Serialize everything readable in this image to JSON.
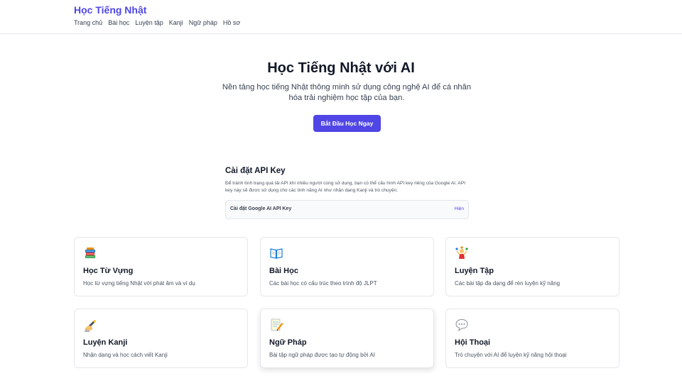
{
  "header": {
    "brand": "Học Tiếng Nhật",
    "nav": [
      "Trang chủ",
      "Bài học",
      "Luyện tập",
      "Kanji",
      "Ngữ pháp",
      "Hồ sơ"
    ]
  },
  "hero": {
    "title": "Học Tiếng Nhật với AI",
    "subtitle": "Nền tảng học tiếng Nhật thông minh sử dụng công nghệ AI để cá nhân hóa trải nghiệm học tập của bạn.",
    "cta_label": "Bắt Đầu Học Ngay"
  },
  "api_key": {
    "title": "Cài đặt API Key",
    "description": "Để tránh tình trạng quá tải API khi nhiều người cùng sử dụng, bạn có thể cấu hình API key riêng của Google AI. API key này sẽ được sử dụng cho các tính năng AI như nhận dạng Kanji và trò chuyện.",
    "box_label": "Cài đặt Google AI API Key",
    "toggle_label": "Hiện"
  },
  "cards": [
    {
      "icon": "books-icon",
      "title": "Học Từ Vựng",
      "desc": "Học từ vựng tiếng Nhật với phát âm và ví dụ"
    },
    {
      "icon": "open-book-icon",
      "title": "Bài Học",
      "desc": "Các bài học có cấu trúc theo trình độ JLPT"
    },
    {
      "icon": "juggler-icon",
      "title": "Luyện Tập",
      "desc": "Các bài tập đa dạng để rèn luyện kỹ năng"
    },
    {
      "icon": "writing-hand-icon",
      "title": "Luyện Kanji",
      "desc": "Nhận dạng và học cách viết Kanji"
    },
    {
      "icon": "memo-icon",
      "title": "Ngữ Pháp",
      "desc": "Bài tập ngữ pháp được tạo tự động bởi AI"
    },
    {
      "icon": "speech-bubble-icon",
      "title": "Hội Thoại",
      "desc": "Trò chuyện với AI để luyện kỹ năng hội thoại"
    }
  ],
  "colors": {
    "accent": "#4f46e5",
    "border": "#e5e7eb",
    "text": "#111827",
    "muted": "#4b5563"
  }
}
